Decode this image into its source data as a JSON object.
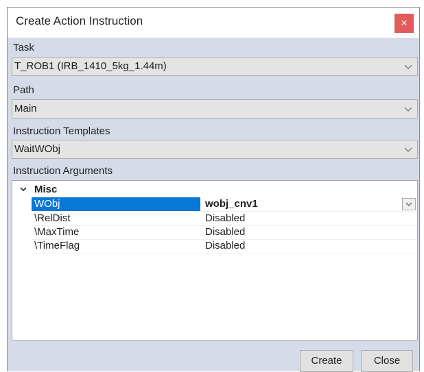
{
  "dialog": {
    "title": "Create Action Instruction",
    "close_symbol": "×"
  },
  "task": {
    "label": "Task",
    "value": "T_ROB1 (IRB_1410_5kg_1.44m)"
  },
  "path": {
    "label": "Path",
    "value": "Main"
  },
  "templates": {
    "label": "Instruction Templates",
    "value": "WaitWObj"
  },
  "arguments": {
    "label": "Instruction Arguments",
    "category": "Misc",
    "rows": [
      {
        "name": "WObj",
        "value": "wobj_cnv1"
      },
      {
        "name": "\\RelDist",
        "value": "Disabled"
      },
      {
        "name": "\\MaxTime",
        "value": "Disabled"
      },
      {
        "name": "\\TimeFlag",
        "value": "Disabled"
      }
    ]
  },
  "buttons": {
    "create": "Create",
    "close": "Close"
  },
  "colors": {
    "selection": "#0a78d7",
    "close_button": "#e35b5b",
    "dialog_bg": "#d6dbe9"
  }
}
